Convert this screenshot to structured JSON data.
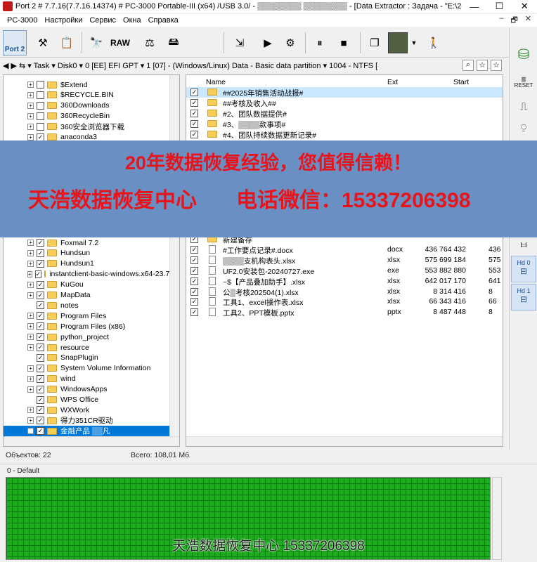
{
  "window": {
    "title": "Port 2 # 7.7.16(7.7.16.14374) # PC-3000 Portable-III (x64) /USB 3.0/ - ▒▒▒▒▒▒▒▒ ▒▒▒▒▒▒▒▒ - [Data Extractor : Задача - \"E:\\2025\\7.4...",
    "controls": [
      "—",
      "☐",
      "✕"
    ]
  },
  "menu": {
    "app": "PC-3000",
    "items": [
      "Настройки",
      "Сервис",
      "Окна",
      "Справка"
    ],
    "right_controls": [
      "–",
      "🗗",
      "✕"
    ]
  },
  "toolbar": {
    "port_label": "Port 2",
    "raw_label": "RAW"
  },
  "pathbar": {
    "text": "◀ ▶ ⇆ ▾  Task ▾  Disk0 ▾  0 [EE] EFI GPT ▾  1 [07] - (Windows/Linux) Data - Basic data partition ▾  1004 - NTFS [ "
  },
  "right_panel": {
    "reset_label": "RESET",
    "hd0": "Hd 0",
    "hd1": "Hd 1"
  },
  "tree": {
    "top_rows": [
      {
        "label": "$Extend",
        "checked": false,
        "expandable": true
      },
      {
        "label": "$RECYCLE.BIN",
        "checked": false,
        "expandable": true
      },
      {
        "label": "360Downloads",
        "checked": false,
        "expandable": true
      },
      {
        "label": "360RecycleBin",
        "checked": false,
        "expandable": true
      },
      {
        "label": "360安全浏览器下载",
        "checked": false,
        "expandable": true
      },
      {
        "label": "anaconda3",
        "checked": true,
        "expandable": true
      }
    ],
    "bottom_rows": [
      {
        "label": "Foxmail 7.2",
        "checked": true,
        "expandable": true
      },
      {
        "label": "Hundsun",
        "checked": true,
        "expandable": true
      },
      {
        "label": "Hundsun1",
        "checked": true,
        "expandable": true
      },
      {
        "label": "instantclient-basic-windows.x64-23.7.0",
        "checked": true,
        "expandable": true
      },
      {
        "label": "KuGou",
        "checked": true,
        "expandable": true
      },
      {
        "label": "MapData",
        "checked": true,
        "expandable": true
      },
      {
        "label": "notes",
        "checked": true,
        "expandable": false
      },
      {
        "label": "Program Files",
        "checked": true,
        "expandable": true
      },
      {
        "label": "Program Files (x86)",
        "checked": true,
        "expandable": true
      },
      {
        "label": "python_project",
        "checked": true,
        "expandable": true
      },
      {
        "label": "resource",
        "checked": true,
        "expandable": true
      },
      {
        "label": "SnapPlugin",
        "checked": true,
        "expandable": false
      },
      {
        "label": "System Volume Information",
        "checked": true,
        "expandable": true
      },
      {
        "label": "wind",
        "checked": true,
        "expandable": true
      },
      {
        "label": "WindowsApps",
        "checked": true,
        "expandable": true
      },
      {
        "label": "WPS Office",
        "checked": true,
        "expandable": false
      },
      {
        "label": "WXWork",
        "checked": true,
        "expandable": true
      },
      {
        "label": "得力351CR驱动",
        "checked": true,
        "expandable": true
      },
      {
        "label": "金融产品 ▒▒凡",
        "checked": true,
        "expandable": true,
        "selected": true
      }
    ]
  },
  "files": {
    "columns": {
      "name": "Name",
      "ext": "Ext",
      "start": "Start"
    },
    "top_rows": [
      {
        "name": "##2025年销售活动战报#",
        "ext": "",
        "start": "",
        "trunc": "",
        "type": "folder",
        "selected": true
      },
      {
        "name": "##考核及收入##",
        "ext": "",
        "start": "",
        "trunc": "",
        "type": "folder"
      },
      {
        "name": "#2、团队数据提供#",
        "ext": "",
        "start": "",
        "trunc": "",
        "type": "folder"
      },
      {
        "name": "#3、▒▒▒▒款事项#",
        "ext": "",
        "start": "",
        "trunc": "",
        "type": "folder"
      },
      {
        "name": "#4、团队持续数据更新记录#",
        "ext": "",
        "start": "",
        "trunc": "",
        "type": "folder"
      }
    ],
    "bottom_rows": [
      {
        "name": "新建备存",
        "ext": "",
        "start": "",
        "trunc": "",
        "type": "folder"
      },
      {
        "name": "#工作要点记录#.docx",
        "ext": "docx",
        "start": "436 764 432",
        "trunc": "436",
        "type": "doc"
      },
      {
        "name": "▒▒▒▒支机构表头.xlsx",
        "ext": "xlsx",
        "start": "575 699 184",
        "trunc": "575",
        "type": "doc"
      },
      {
        "name": "UF2.0安装包-20240727.exe",
        "ext": "exe",
        "start": "553 882 880",
        "trunc": "553",
        "type": "doc"
      },
      {
        "name": "~$【产品叠加助手】.xlsx",
        "ext": "xlsx",
        "start": "642 017 170",
        "trunc": "641",
        "type": "doc"
      },
      {
        "name": "公▒考核202504(1).xlsx",
        "ext": "xlsx",
        "start": "8 314 416",
        "trunc": "8",
        "type": "doc"
      },
      {
        "name": "工具1、excel操作表.xlsx",
        "ext": "xlsx",
        "start": "66 343 416",
        "trunc": "66",
        "type": "doc"
      },
      {
        "name": "工具2、PPT模板.pptx",
        "ext": "pptx",
        "start": "8 487 448",
        "trunc": "8",
        "type": "doc"
      }
    ]
  },
  "status": {
    "objects": "Объектов: 22",
    "total": "Всего: 108,01 Мб"
  },
  "map": {
    "label": "0 - Default"
  },
  "overlay": {
    "line1": "20年数据恢复经验，您值得信赖！",
    "line2a": "天浩数据恢复中心",
    "line2b": "电话微信：15337206398",
    "watermark": "天浩数据恢复中心 15337206398"
  }
}
